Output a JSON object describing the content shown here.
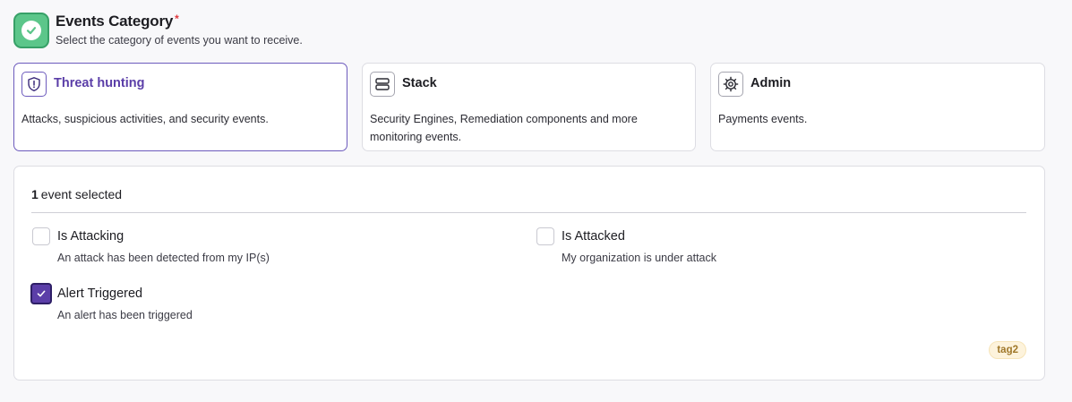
{
  "header": {
    "title": "Events Category",
    "required_mark": "*",
    "subtitle": "Select the category of events you want to receive.",
    "step_icon": "check-circle-icon",
    "step_color": "#5cc68a"
  },
  "categories": [
    {
      "label": "Threat hunting",
      "description": "Attacks, suspicious activities, and security events.",
      "icon": "shield-alert-icon",
      "selected": true
    },
    {
      "label": "Stack",
      "description": "Security Engines, Remediation components and more monitoring events.",
      "icon": "server-stack-icon",
      "selected": false
    },
    {
      "label": "Admin",
      "description": "Payments events.",
      "icon": "gear-icon",
      "selected": false
    }
  ],
  "events_panel": {
    "count": "1",
    "count_suffix": "event selected",
    "events": [
      {
        "title": "Is Attacking",
        "description": "An attack has been detected from my IP(s)",
        "checked": false
      },
      {
        "title": "Is Attacked",
        "description": "My organization is under attack",
        "checked": false
      },
      {
        "title": "Alert Triggered",
        "description": "An alert has been triggered",
        "checked": true
      }
    ],
    "tag": "tag2"
  },
  "colors": {
    "accent": "#5b3ea8",
    "success": "#5cc68a",
    "tag_bg": "#fdf3dc",
    "tag_text": "#a0782a"
  }
}
